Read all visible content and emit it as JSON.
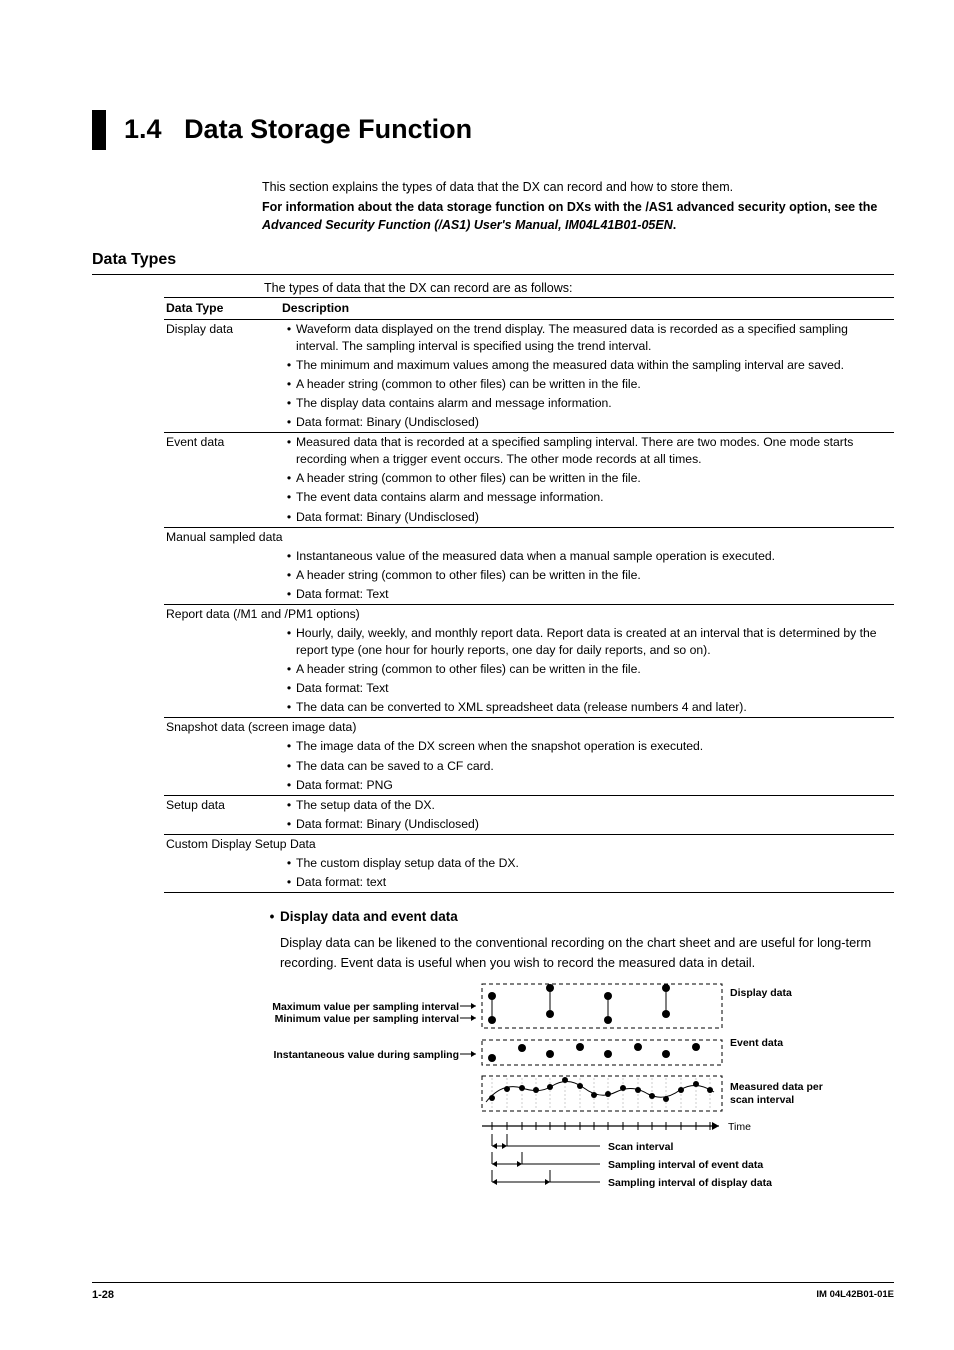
{
  "section_number": "1.4",
  "section_title": "Data Storage Function",
  "intro_line": "This section explains the types of data that the DX can record and how to store them.",
  "intro_bold_prefix": "For information about the data storage function on DXs with the /AS1 advanced security option, see the ",
  "intro_italic": "Advanced Security Function (/AS1) User's Manual, IM04L41B01-05EN",
  "intro_bold_suffix": ".",
  "heading_data_types": "Data Types",
  "data_types_intro": "The types of data that the DX can record are as follows:",
  "table": {
    "headers": [
      "Data Type",
      "Description"
    ],
    "rows": [
      {
        "type": "Display data",
        "span": false,
        "items": [
          "Waveform data displayed on the trend display. The measured data is recorded as a specified sampling interval. The sampling interval is specified using the trend interval.",
          "The minimum and maximum values among the measured data within the sampling interval are saved.",
          "A header string (common to other files) can be written in the file.",
          "The display data contains alarm and message information.",
          "Data format: Binary (Undisclosed)"
        ]
      },
      {
        "type": "Event data",
        "span": false,
        "items": [
          "Measured data that is recorded at a specified sampling interval. There are two modes. One mode starts recording when a trigger event occurs. The other mode records at all times.",
          "A header string (common to other files) can be written in the file.",
          "The event data contains alarm and message information.",
          "Data format: Binary (Undisclosed)"
        ]
      },
      {
        "type": "Manual sampled data",
        "span": true,
        "items": [
          "Instantaneous value of the measured data when a manual sample operation is executed.",
          "A header string (common to other files) can be written in the file.",
          "Data format: Text"
        ]
      },
      {
        "type": "Report data (/M1 and /PM1 options)",
        "span": true,
        "items": [
          "Hourly, daily, weekly, and monthly report data. Report data is created at an interval that is determined by the report type (one hour for hourly reports, one day for daily reports, and so on).",
          "A header string (common to other files) can be written in the file.",
          "Data format: Text",
          "The data can be converted to XML spreadsheet data (release numbers 4 and later)."
        ]
      },
      {
        "type": "Snapshot data (screen image data)",
        "span": true,
        "items": [
          "The image data of the DX screen when the snapshot operation is executed.",
          "The data can be saved to a CF card.",
          "Data format: PNG"
        ]
      },
      {
        "type": "Setup data",
        "span": false,
        "items": [
          "The setup data of the DX.",
          "Data format: Binary (Undisclosed)"
        ]
      },
      {
        "type": "Custom Display Setup Data",
        "span": true,
        "items": [
          "The custom display setup data of the DX.",
          "Data format: text"
        ]
      }
    ]
  },
  "subsection": {
    "title": "Display data and event data",
    "body": "Display data can be likened to the conventional recording on the chart sheet and are useful for long-term recording. Event data is useful when you wish to record the measured data in detail."
  },
  "diagram": {
    "max_label": "Maximum value per sampling interval",
    "min_label": "Minimum value per sampling interval",
    "inst_label": "Instantaneous value during sampling",
    "display_data_label": "Display data",
    "event_data_label": "Event data",
    "measured_label1": "Measured data per",
    "measured_label2": "scan interval",
    "time_label": "Time",
    "scan_interval_label": "Scan interval",
    "sampling_event_label": "Sampling interval of event data",
    "sampling_display_label": "Sampling interval of display data"
  },
  "footer": {
    "page": "1-28",
    "docid": "IM 04L42B01-01E"
  }
}
